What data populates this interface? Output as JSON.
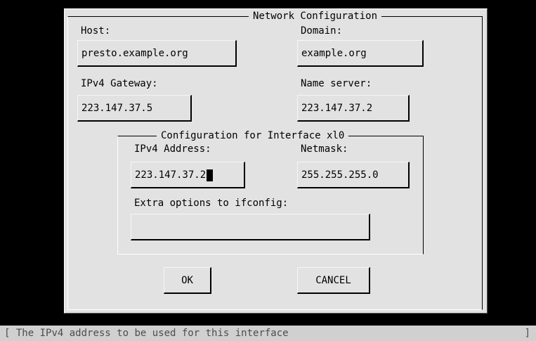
{
  "dialog": {
    "title": "Network Configuration",
    "host_label": "Host:",
    "host_value": "presto.example.org",
    "domain_label": "Domain:",
    "domain_value": "example.org",
    "gateway_label": "IPv4 Gateway:",
    "gateway_value": "223.147.37.5",
    "nameserver_label": "Name server:",
    "nameserver_value": "223.147.37.2"
  },
  "interface": {
    "title": "Configuration for Interface xl0",
    "ipv4_label": "IPv4 Address:",
    "ipv4_value": "223.147.37.2",
    "netmask_label": "Netmask:",
    "netmask_value": "255.255.255.0",
    "extra_label": "Extra options to ifconfig:",
    "extra_value": ""
  },
  "buttons": {
    "ok": "OK",
    "cancel": "CANCEL"
  },
  "status": {
    "left_bracket": "[",
    "text": "The IPv4 address to be used for this interface",
    "right_bracket": "]"
  }
}
